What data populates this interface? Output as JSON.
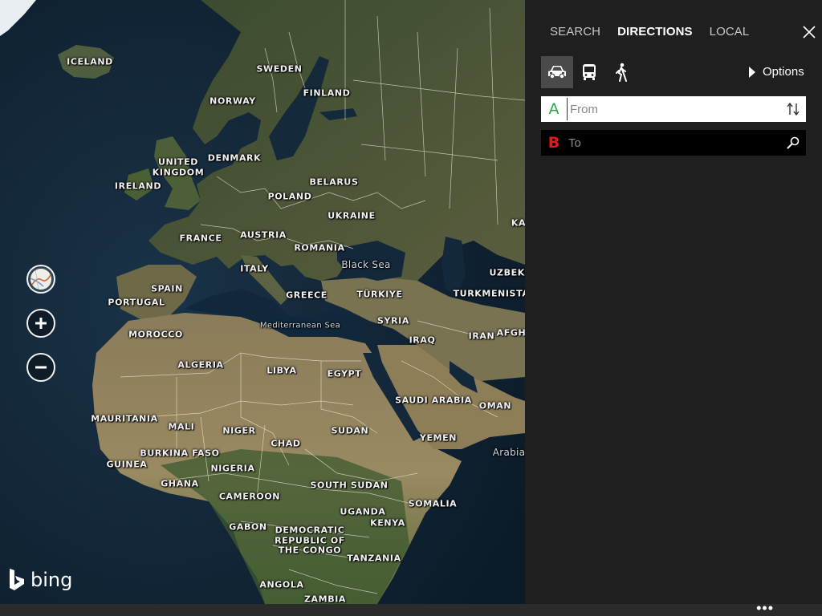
{
  "map": {
    "labels": [
      {
        "id": "iceland",
        "text": "ICELAND"
      },
      {
        "id": "sweden",
        "text": "SWEDEN"
      },
      {
        "id": "norway",
        "text": "NORWAY"
      },
      {
        "id": "finland",
        "text": "FINLAND"
      },
      {
        "id": "united_kingdom_1",
        "text": "UNITED"
      },
      {
        "id": "united_kingdom_2",
        "text": "KINGDOM"
      },
      {
        "id": "denmark",
        "text": "DENMARK"
      },
      {
        "id": "ireland",
        "text": "IRELAND"
      },
      {
        "id": "belarus",
        "text": "BELARUS"
      },
      {
        "id": "poland",
        "text": "POLAND"
      },
      {
        "id": "ukraine",
        "text": "UKRAINE"
      },
      {
        "id": "france",
        "text": "FRANCE"
      },
      {
        "id": "austria",
        "text": "AUSTRIA"
      },
      {
        "id": "romania",
        "text": "ROMANIA"
      },
      {
        "id": "italy",
        "text": "ITALY"
      },
      {
        "id": "black_sea",
        "text": "Black Sea"
      },
      {
        "id": "uzbek",
        "text": "UZBEKI"
      },
      {
        "id": "spain",
        "text": "SPAIN"
      },
      {
        "id": "portugal",
        "text": "PORTUGAL"
      },
      {
        "id": "greece",
        "text": "GREECE"
      },
      {
        "id": "turkiye",
        "text": "TÜRKIYE"
      },
      {
        "id": "turkmenistan",
        "text": "TURKMENISTA"
      },
      {
        "id": "mediterranean",
        "text": "Mediterranean Sea"
      },
      {
        "id": "syria",
        "text": "SYRIA"
      },
      {
        "id": "morocco",
        "text": "MOROCCO"
      },
      {
        "id": "iraq",
        "text": "IRAQ"
      },
      {
        "id": "iran",
        "text": "IRAN"
      },
      {
        "id": "afgh",
        "text": "AFGH"
      },
      {
        "id": "algeria",
        "text": "ALGERIA"
      },
      {
        "id": "libya",
        "text": "LIBYA"
      },
      {
        "id": "egypt",
        "text": "EGYPT"
      },
      {
        "id": "saudi_arabia",
        "text": "SAUDI ARABIA"
      },
      {
        "id": "oman",
        "text": "OMAN"
      },
      {
        "id": "mauritania",
        "text": "MAURITANIA"
      },
      {
        "id": "mali",
        "text": "MALI"
      },
      {
        "id": "niger",
        "text": "NIGER"
      },
      {
        "id": "chad",
        "text": "CHAD"
      },
      {
        "id": "sudan",
        "text": "SUDAN"
      },
      {
        "id": "yemen",
        "text": "YEMEN"
      },
      {
        "id": "arabia_sea",
        "text": "Arabia"
      },
      {
        "id": "burkina_faso",
        "text": "BURKINA FASO"
      },
      {
        "id": "guinea",
        "text": "GUINEA"
      },
      {
        "id": "nigeria",
        "text": "NIGERIA"
      },
      {
        "id": "ghana",
        "text": "GHANA"
      },
      {
        "id": "south_sudan",
        "text": "SOUTH SUDAN"
      },
      {
        "id": "cameroon",
        "text": "CAMEROON"
      },
      {
        "id": "somalia",
        "text": "SOMALIA"
      },
      {
        "id": "uganda",
        "text": "UGANDA"
      },
      {
        "id": "kenya",
        "text": "KENYA"
      },
      {
        "id": "gabon",
        "text": "GABON"
      },
      {
        "id": "drc_1",
        "text": "DEMOCRATIC"
      },
      {
        "id": "drc_2",
        "text": "REPUBLIC OF"
      },
      {
        "id": "drc_3",
        "text": "THE CONGO"
      },
      {
        "id": "tanzania",
        "text": "TANZANIA"
      },
      {
        "id": "angola",
        "text": "ANGOLA"
      },
      {
        "id": "zambia",
        "text": "ZAMBIA"
      },
      {
        "id": "kaz",
        "text": "KA"
      }
    ],
    "controls": {
      "map_style_icon": "map-style-icon",
      "zoom_in_icon": "plus-icon",
      "zoom_out_icon": "minus-icon"
    },
    "logo_text": "bing"
  },
  "panel": {
    "tabs": [
      {
        "label": "SEARCH",
        "active": false
      },
      {
        "label": "DIRECTIONS",
        "active": true
      },
      {
        "label": "LOCAL",
        "active": false
      }
    ],
    "close_icon": "close-icon",
    "modes": [
      {
        "name": "car-icon",
        "selected": true
      },
      {
        "name": "bus-icon",
        "selected": false
      },
      {
        "name": "walk-icon",
        "selected": false
      }
    ],
    "options_label": "Options",
    "from": {
      "letter": "A",
      "placeholder": "From",
      "value": "",
      "icon": "swap-icon"
    },
    "to": {
      "letter": "B",
      "placeholder": "To",
      "value": "",
      "icon": "search-icon"
    }
  },
  "bottom_bar": {
    "more_icon": "more-icon",
    "more_text": "•••"
  },
  "colors": {
    "panel_bg": "#1f1f1f",
    "from_letter": "#2aa84a",
    "to_letter": "#e01a1a",
    "ocean": "#0f2233"
  }
}
